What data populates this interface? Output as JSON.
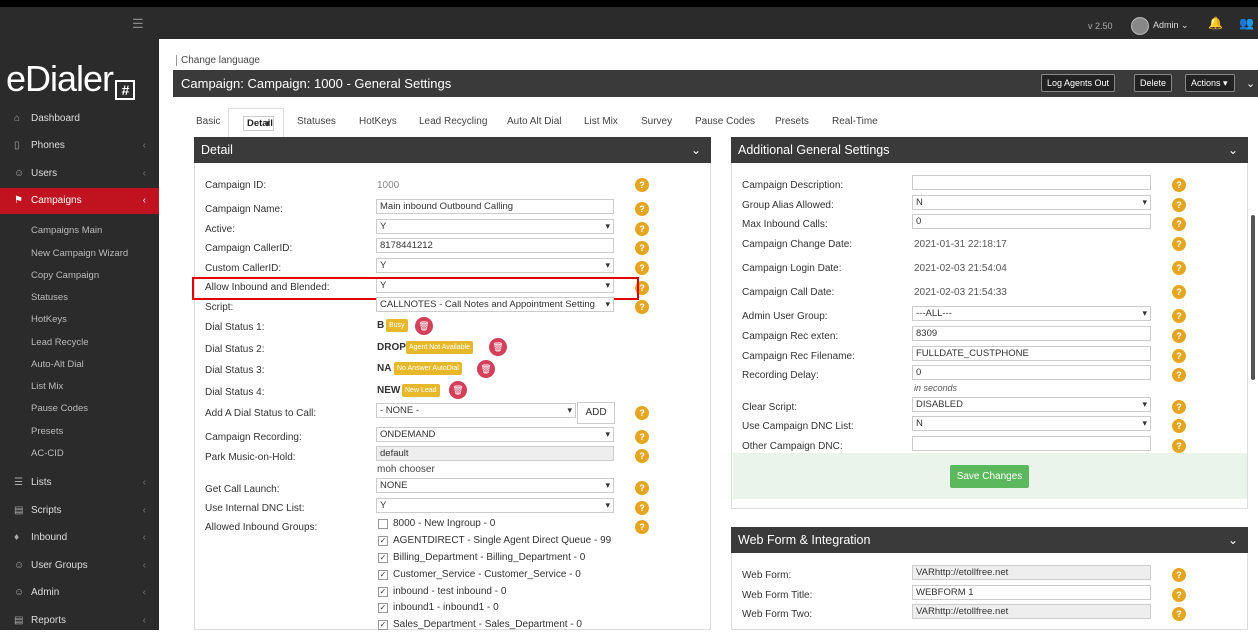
{
  "topbar": {
    "version": "v 2.50",
    "admin": "Admin",
    "hamburger": "☰",
    "admin_caret": "⌄"
  },
  "logo": {
    "text": "eDialer",
    "mark": "#"
  },
  "sidebar": {
    "items": [
      {
        "label": "Dashboard",
        "icon": "⌂"
      },
      {
        "label": "Phones",
        "icon": "▯"
      },
      {
        "label": "Users",
        "icon": "☺"
      },
      {
        "label": "Campaigns",
        "icon": "⚑"
      },
      {
        "label": "Lists",
        "icon": "☰"
      },
      {
        "label": "Scripts",
        "icon": "▤"
      },
      {
        "label": "Inbound",
        "icon": "♦"
      },
      {
        "label": "User Groups",
        "icon": "☺"
      },
      {
        "label": "Admin",
        "icon": "☺"
      },
      {
        "label": "Reports",
        "icon": "▤"
      }
    ],
    "campaign_sub": [
      "Campaigns Main",
      "New Campaign Wizard",
      "Copy Campaign",
      "Statuses",
      "HotKeys",
      "Lead Recycle",
      "Auto-Alt Dial",
      "List Mix",
      "Pause Codes",
      "Presets",
      "AC-CID"
    ]
  },
  "header": {
    "change_language": "Change language",
    "title": "Campaign: Campaign: 1000 - General Settings",
    "buttons": {
      "log_agents_out": "Log Agents Out",
      "delete": "Delete",
      "actions": "Actions"
    }
  },
  "tabs": [
    "Basic",
    "Detail",
    "Statuses",
    "HotKeys",
    "Lead Recycling",
    "Auto Alt Dial",
    "List Mix",
    "Survey",
    "Pause Codes",
    "Presets",
    "Real-Time"
  ],
  "detail": {
    "title": "Detail",
    "campaign_id_label": "Campaign ID:",
    "campaign_id": "1000",
    "campaign_name_label": "Campaign Name:",
    "campaign_name": "Main inbound Outbound Calling",
    "active_label": "Active:",
    "active": "Y",
    "callerid_label": "Campaign CallerID:",
    "callerid": "8178441212",
    "custom_callerid_label": "Custom CallerID:",
    "custom_callerid": "Y",
    "allow_inbound_label": "Allow Inbound and Blended:",
    "allow_inbound": "Y",
    "script_label": "Script:",
    "script": "CALLNOTES - Call Notes and Appointment Setting",
    "dial_status_1_label": "Dial Status 1:",
    "dial_status_1_code": "B",
    "dial_status_1_name": "Busy",
    "dial_status_2_label": "Dial Status 2:",
    "dial_status_2_code": "DROP",
    "dial_status_2_name": "Agent Not Available",
    "dial_status_3_label": "Dial Status 3:",
    "dial_status_3_code": "NA",
    "dial_status_3_name": "No Answer AutoDial",
    "dial_status_4_label": "Dial Status 4:",
    "dial_status_4_code": "NEW",
    "dial_status_4_name": "New Lead",
    "add_dial_status_label": "Add A Dial Status to Call:",
    "add_dial_status": "- NONE -",
    "add_button": "ADD",
    "recording_label": "Campaign Recording:",
    "recording": "ONDEMAND",
    "park_label": "Park Music-on-Hold:",
    "park": "default",
    "park_chooser": "moh chooser",
    "get_call_launch_label": "Get Call Launch:",
    "get_call_launch": "NONE",
    "internal_dnc_label": "Use Internal DNC List:",
    "internal_dnc": "Y",
    "inbound_groups_label": "Allowed Inbound Groups:",
    "inbound_groups": [
      {
        "label": "8000 - New Ingroup - 0",
        "checked": false
      },
      {
        "label": "AGENTDIRECT - Single Agent Direct Queue - 99",
        "checked": true
      },
      {
        "label": "Billing_Department - Billing_Department - 0",
        "checked": true
      },
      {
        "label": "Customer_Service - Customer_Service - 0",
        "checked": true
      },
      {
        "label": "inbound - test inbound - 0",
        "checked": true
      },
      {
        "label": "inbound1 - inbound1 - 0",
        "checked": true
      },
      {
        "label": "Sales_Department - Sales_Department - 0",
        "checked": true
      }
    ],
    "check_mark": "✓",
    "help": "?",
    "trash": "🗑"
  },
  "additional": {
    "title": "Additional General Settings",
    "description_label": "Campaign Description:",
    "description": "",
    "group_alias_label": "Group Alias Allowed:",
    "group_alias": "N",
    "max_inbound_label": "Max Inbound Calls:",
    "max_inbound": "0",
    "change_date_label": "Campaign Change Date:",
    "change_date": "2021-01-31 22:18:17",
    "login_date_label": "Campaign Login Date:",
    "login_date": "2021-02-03 21:54:04",
    "call_date_label": "Campaign Call Date:",
    "call_date": "2021-02-03 21:54:33",
    "admin_user_group_label": "Admin User Group:",
    "admin_user_group": "---ALL---",
    "rec_exten_label": "Campaign Rec exten:",
    "rec_exten": "8309",
    "rec_filename_label": "Campaign Rec Filename:",
    "rec_filename": "FULLDATE_CUSTPHONE",
    "recording_delay_label": "Recording Delay:",
    "recording_delay": "0",
    "in_seconds": "in seconds",
    "clear_script_label": "Clear Script:",
    "clear_script": "DISABLED",
    "campaign_dnc_label": "Use Campaign DNC List:",
    "campaign_dnc": "N",
    "other_dnc_label": "Other Campaign DNC:",
    "other_dnc": "",
    "save": "Save Changes"
  },
  "webform": {
    "title": "Web Form & Integration",
    "web_form_label": "Web Form:",
    "web_form": "VARhttp://etollfree.net",
    "web_form_title_label": "Web Form Title:",
    "web_form_title": "WEBFORM 1",
    "web_form_two_label": "Web Form Two:",
    "web_form_two": "VARhttp://etollfree.net"
  },
  "icons": {
    "collapse": "⌄",
    "bell": "🔔",
    "users": "👥",
    "caret": "▾",
    "chev_left": "‹"
  }
}
